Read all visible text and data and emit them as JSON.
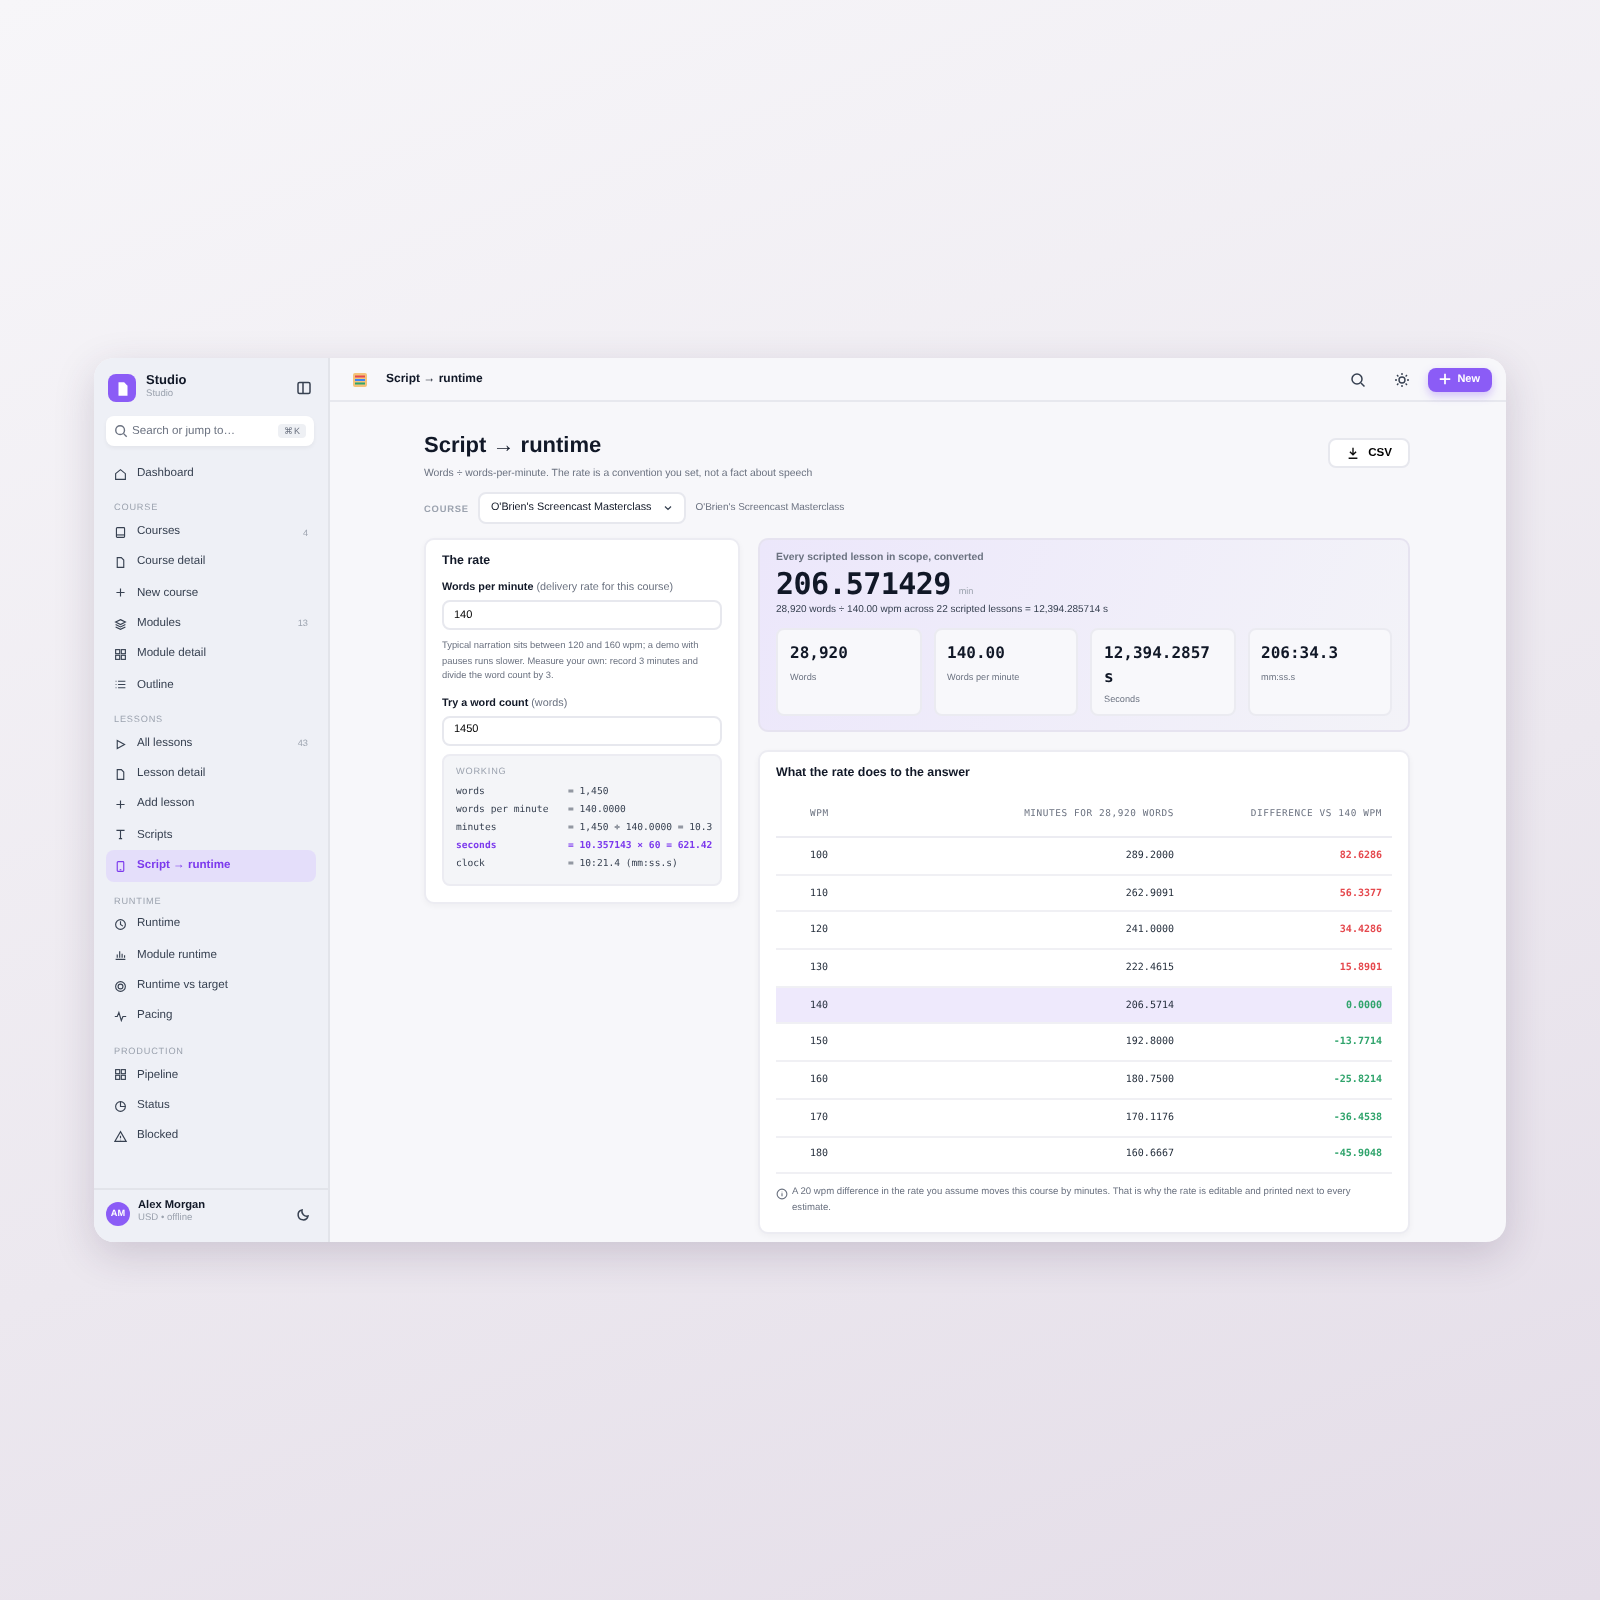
{
  "app": {
    "name": "Studio",
    "subtitle": "Studio"
  },
  "search": {
    "placeholder": "Search or jump to…",
    "shortcut": "⌘K"
  },
  "sidebar": {
    "items": [
      {
        "label": "Dashboard",
        "selected": false
      }
    ],
    "sections": [
      {
        "title": "COURSE",
        "items": [
          {
            "label": "Courses",
            "count": "4",
            "selected": false
          },
          {
            "label": "Course detail",
            "selected": false
          },
          {
            "label": "New course",
            "selected": false
          },
          {
            "label": "Modules",
            "count": "13",
            "selected": false
          },
          {
            "label": "Module detail",
            "selected": false
          },
          {
            "label": "Outline",
            "selected": false
          }
        ]
      },
      {
        "title": "LESSONS",
        "items": [
          {
            "label": "All lessons",
            "count": "43",
            "selected": false
          },
          {
            "label": "Lesson detail",
            "selected": false
          },
          {
            "label": "Add lesson",
            "selected": false
          },
          {
            "label": "Scripts",
            "selected": false
          },
          {
            "label": "Script → runtime",
            "selected": true
          }
        ]
      },
      {
        "title": "RUNTIME",
        "items": [
          {
            "label": "Runtime",
            "selected": false
          },
          {
            "label": "Module runtime",
            "selected": false
          },
          {
            "label": "Runtime vs target",
            "selected": false
          },
          {
            "label": "Pacing",
            "selected": false
          }
        ]
      },
      {
        "title": "PRODUCTION",
        "items": [
          {
            "label": "Pipeline",
            "selected": false
          },
          {
            "label": "Status",
            "selected": false
          },
          {
            "label": "Blocked",
            "selected": false
          }
        ]
      }
    ]
  },
  "user": {
    "initials": "AM",
    "name": "Alex Morgan",
    "detail": "USD • offline"
  },
  "header": {
    "breadcrumb": "Script → runtime",
    "new_button": "New"
  },
  "page": {
    "title": "Script → runtime",
    "subtitle": "Words ÷ words-per-minute. The rate is a convention you set, not a fact about speech",
    "export_button": "CSV",
    "course_label": "COURSE",
    "course_select": "O'Brien's Screencast Masterclass",
    "course_note": "O'Brien's Screencast Masterclass"
  },
  "rate_card": {
    "title": "The rate",
    "wpm_label": "Words per minute",
    "wpm_hint": "(delivery rate for this course)",
    "wpm_value": "140",
    "help": "Typical narration sits between 120 and 160 wpm; a demo with pauses runs slower. Measure your own: record 3 minutes and divide the word count by 3.",
    "count_label": "Try a word count",
    "count_hint": "(words)",
    "count_value": "1450",
    "working_title": "WORKING",
    "working": [
      {
        "name": "words",
        "expr": "= 1,450",
        "highlight": false
      },
      {
        "name": "words per minute",
        "expr": "= 140.0000",
        "highlight": false
      },
      {
        "name": "minutes",
        "expr": "= 1,450 ÷ 140.0000 = 10.3",
        "highlight": false
      },
      {
        "name": "seconds",
        "expr": "= 10.357143 × 60 = 621.42",
        "highlight": true
      },
      {
        "name": "clock",
        "expr": "= 10:21.4  (mm:ss.s)",
        "highlight": false
      }
    ]
  },
  "summary": {
    "caption": "Every scripted lesson in scope, converted",
    "value": "206.571429",
    "unit": "min",
    "formula": "28,920 words ÷ 140.00 wpm across 22 scripted lessons = 12,394.285714 s",
    "stats": [
      {
        "value": "28,920",
        "label": "Words"
      },
      {
        "value": "140.00",
        "label": "Words per minute"
      },
      {
        "value": "12,394.2857 s",
        "label": "Seconds"
      },
      {
        "value": "206:34.3",
        "label": "mm:ss.s"
      }
    ]
  },
  "table": {
    "title": "What the rate does to the answer",
    "columns": [
      "WPM",
      "MINUTES FOR 28,920 WORDS",
      "DIFFERENCE VS 140 WPM"
    ],
    "rows": [
      {
        "wpm": "100",
        "minutes": "289.2000",
        "difference": "82.6286",
        "color": "#e5484d",
        "selected": false
      },
      {
        "wpm": "110",
        "minutes": "262.9091",
        "difference": "56.3377",
        "color": "#e5484d",
        "selected": false
      },
      {
        "wpm": "120",
        "minutes": "241.0000",
        "difference": "34.4286",
        "color": "#e5484d",
        "selected": false
      },
      {
        "wpm": "130",
        "minutes": "222.4615",
        "difference": "15.8901",
        "color": "#e5484d",
        "selected": false
      },
      {
        "wpm": "140",
        "minutes": "206.5714",
        "difference": "0.0000",
        "color": "#30a46c",
        "selected": true
      },
      {
        "wpm": "150",
        "minutes": "192.8000",
        "difference": "-13.7714",
        "color": "#30a46c",
        "selected": false
      },
      {
        "wpm": "160",
        "minutes": "180.7500",
        "difference": "-25.8214",
        "color": "#30a46c",
        "selected": false
      },
      {
        "wpm": "170",
        "minutes": "170.1176",
        "difference": "-36.4538",
        "color": "#30a46c",
        "selected": false
      },
      {
        "wpm": "180",
        "minutes": "160.6667",
        "difference": "-45.9048",
        "color": "#30a46c",
        "selected": false
      }
    ],
    "note": "A 20 wpm difference in the rate you assume moves this course by minutes. That is why the rate is editable and printed next to every estimate."
  }
}
